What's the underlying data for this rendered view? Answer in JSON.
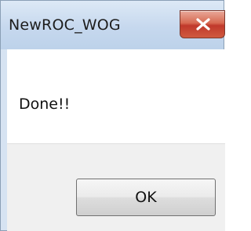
{
  "window": {
    "title": "NewROC_WOG",
    "close_icon": "close-icon"
  },
  "dialog": {
    "message": "Done!!",
    "ok_label": "OK"
  },
  "colors": {
    "close_button": "#c0392b",
    "titlebar": "#c6d8ee",
    "button_area": "#f0f0f0"
  }
}
